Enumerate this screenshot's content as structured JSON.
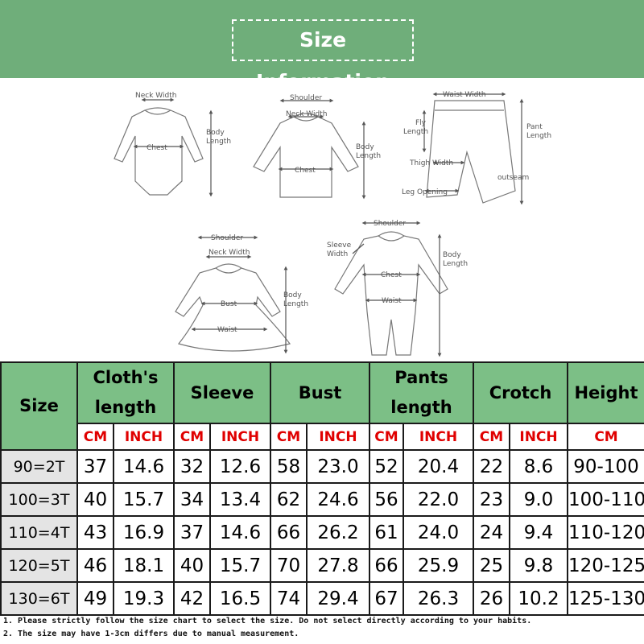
{
  "banner": {
    "title": "Size Information"
  },
  "diagrams": {
    "bodysuit": {
      "neck_width": "Neck Width",
      "chest": "Chest",
      "body_length": [
        "Body",
        "Length"
      ]
    },
    "top": {
      "shoulder": "Shoulder",
      "neck_width": "Neck Width",
      "chest": "Chest",
      "body_length": [
        "Body",
        "Length"
      ]
    },
    "pants": {
      "waist_width": "Waist Width",
      "fly_length": [
        "Fly",
        "Length"
      ],
      "thigh_width": "Thigh Width",
      "leg_opening": "Leg Opening",
      "pant_length": [
        "Pant",
        "Length"
      ],
      "outseam": "outseam"
    },
    "dress": {
      "shoulder": "Shoulder",
      "neck_width": "Neck Width",
      "bust": "Bust",
      "waist": "Waist",
      "body_length": [
        "Body",
        "Length"
      ]
    },
    "romper": {
      "shoulder": "Shoulder",
      "sleeve_width": [
        "Sleeve",
        "Width"
      ],
      "chest": "Chest",
      "waist": "Waist",
      "body_length": [
        "Body",
        "Length"
      ]
    }
  },
  "table": {
    "size_header": "Size",
    "groups": [
      {
        "label": "Cloth's length"
      },
      {
        "label": "Sleeve"
      },
      {
        "label": "Bust"
      },
      {
        "label": "Pants length"
      },
      {
        "label": "Crotch"
      }
    ],
    "height_header": "Height",
    "unit_cm": "CM",
    "unit_inch": "INCH",
    "rows": [
      {
        "size": "90=2T",
        "values": [
          "37",
          "14.6",
          "32",
          "12.6",
          "58",
          "23.0",
          "52",
          "20.4",
          "22",
          "8.6",
          "90-100"
        ]
      },
      {
        "size": "100=3T",
        "values": [
          "40",
          "15.7",
          "34",
          "13.4",
          "62",
          "24.6",
          "56",
          "22.0",
          "23",
          "9.0",
          "100-110"
        ]
      },
      {
        "size": "110=4T",
        "values": [
          "43",
          "16.9",
          "37",
          "14.6",
          "66",
          "26.2",
          "61",
          "24.0",
          "24",
          "9.4",
          "110-120"
        ]
      },
      {
        "size": "120=5T",
        "values": [
          "46",
          "18.1",
          "40",
          "15.7",
          "70",
          "27.8",
          "66",
          "25.9",
          "25",
          "9.8",
          "120-125"
        ]
      },
      {
        "size": "130=6T",
        "values": [
          "49",
          "19.3",
          "42",
          "16.5",
          "74",
          "29.4",
          "67",
          "26.3",
          "26",
          "10.2",
          "125-130"
        ]
      }
    ]
  },
  "notes": [
    "1. Please strictly follow the size chart to select the size. Do not select directly according to your habits.",
    "2. The size may have 1-3cm differs due to manual measurement."
  ],
  "colors": {
    "banner": "#6fae7a",
    "header": "#7cbf86",
    "unit": "#e00000",
    "size_cell": "#e4e4e4"
  }
}
